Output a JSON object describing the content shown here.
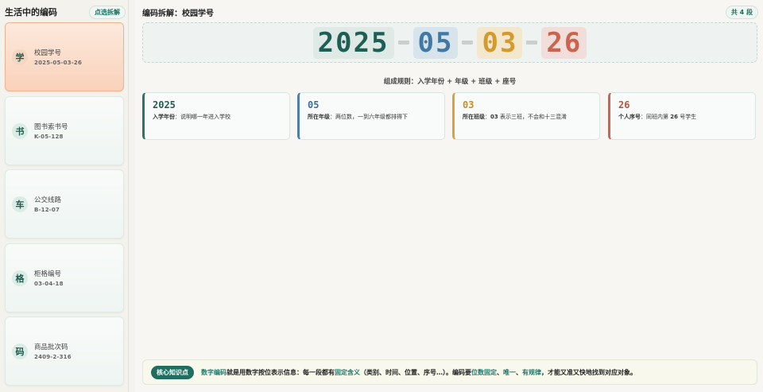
{
  "sidebar": {
    "title": "生活中的编码",
    "hint": "点选拆解",
    "items": [
      {
        "icon": "学",
        "name": "校园学号",
        "code": "2025-05-03-26",
        "active": true
      },
      {
        "icon": "书",
        "name": "图书索书号",
        "code": "K-05-128",
        "active": false
      },
      {
        "icon": "车",
        "name": "公交线路",
        "code": "B-12-07",
        "active": false
      },
      {
        "icon": "格",
        "name": "柜格编号",
        "code": "03-04-18",
        "active": false
      },
      {
        "icon": "码",
        "name": "商品批次码",
        "code": "2409-2-316",
        "active": false
      }
    ]
  },
  "main": {
    "title": "编码拆解：校园学号",
    "segment_count": "共 4 段",
    "code_groups": [
      "2025",
      "05",
      "03",
      "26"
    ],
    "rule": "组成规则：入学年份 + 年级 + 班级 + 座号",
    "segments": [
      {
        "value": "2025",
        "label": "入学年份",
        "desc": "：说明哪一年进入学校"
      },
      {
        "value": "05",
        "label": "所在年级",
        "desc": "：两位数，一到六年级都排得下"
      },
      {
        "value": "03",
        "label": "所在班级",
        "desc_prefix": "：",
        "desc_bold": "03",
        "desc": " 表示三班，不会和十三混淆"
      },
      {
        "value": "26",
        "label": "个人序号",
        "desc_prefix": "：同班内第 ",
        "desc_bold": "26",
        "desc": " 号学生"
      }
    ]
  },
  "tip": {
    "badge": "核心知识点",
    "part1": "数字编码",
    "part2": "就是用数字按位表示信息：每一段都有",
    "part3": "固定含义",
    "part4": "（类别、时间、位置、序号…）。编码要",
    "part5": "位数固定",
    "part6": "、",
    "part7": "唯一",
    "part8": "、",
    "part9": "有规律",
    "part10": "，才能又准又快地找到对应对象。"
  },
  "colors": {
    "accent": "#1f6e60",
    "year": "#1e5f55",
    "grade": "#4079a5",
    "class": "#d49a2e",
    "seat": "#c9644f",
    "active_card": "#f9d2ba"
  }
}
